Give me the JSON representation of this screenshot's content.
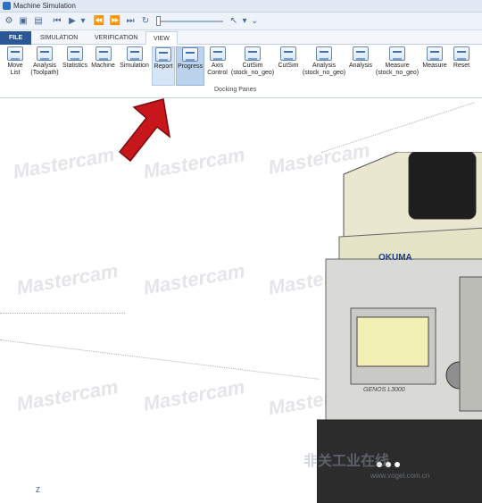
{
  "window": {
    "title": "Machine Simulation"
  },
  "tabs": [
    {
      "label": "FILE"
    },
    {
      "label": "SIMULATION"
    },
    {
      "label": "VERIFICATION"
    },
    {
      "label": "VIEW"
    }
  ],
  "ribbon": {
    "buttons": [
      {
        "line1": "Move",
        "line2": "List"
      },
      {
        "line1": "Analysis",
        "line2": "(Toolpath)"
      },
      {
        "line1": "Statistics",
        "line2": ""
      },
      {
        "line1": "Machine",
        "line2": ""
      },
      {
        "line1": "Simulation",
        "line2": ""
      },
      {
        "line1": "Report",
        "line2": ""
      },
      {
        "line1": "Progress",
        "line2": ""
      },
      {
        "line1": "Axis",
        "line2": "Control"
      },
      {
        "line1": "CutSim",
        "line2": "(stock_no_geo)"
      },
      {
        "line1": "CutSim",
        "line2": ""
      },
      {
        "line1": "Analysis",
        "line2": "(stock_no_geo)"
      },
      {
        "line1": "Analysis",
        "line2": ""
      },
      {
        "line1": "Measure",
        "line2": "(stock_no_geo)"
      },
      {
        "line1": "Measure",
        "line2": ""
      },
      {
        "line1": "Reset",
        "line2": ""
      }
    ],
    "group_label": "Docking Panes"
  },
  "viewport": {
    "watermark": "Mastercam",
    "axis_label": "Z",
    "machine_brand": "OKUMA",
    "machine_model": "GENOS L3000",
    "site_watermark": "非关工业在线",
    "site_url": "www.vogel.com.cn"
  }
}
